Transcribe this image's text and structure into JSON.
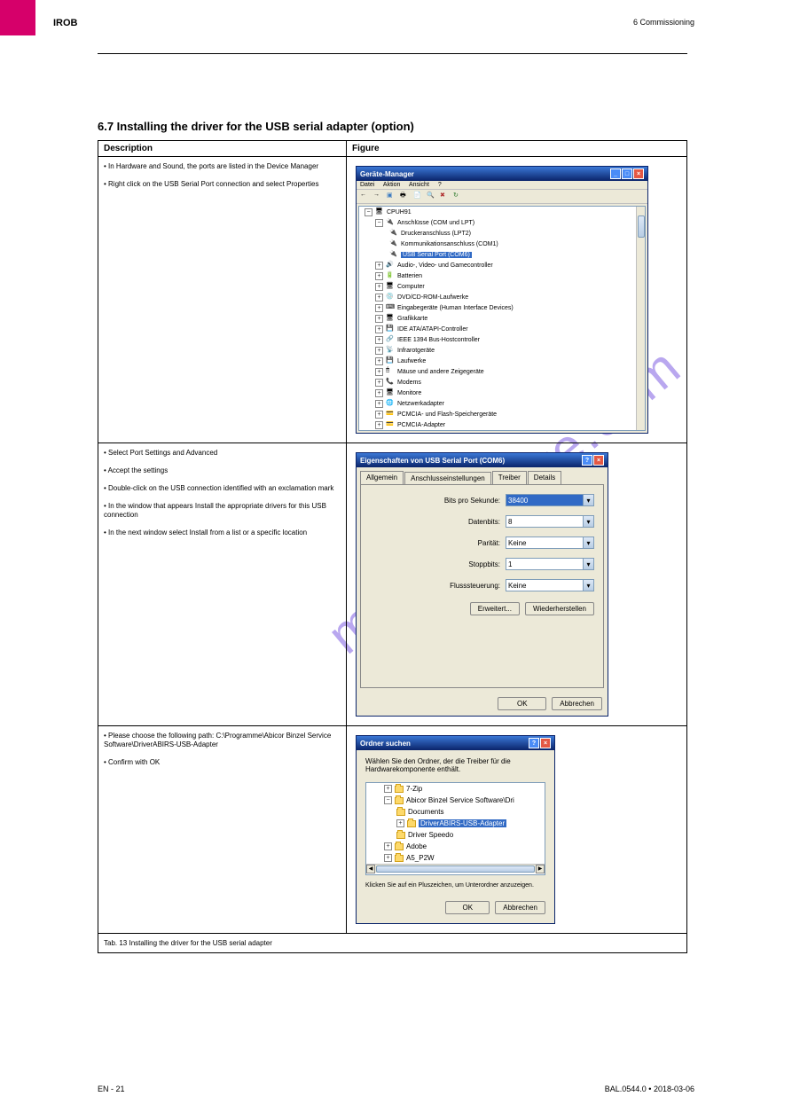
{
  "header": {
    "left": "IROB",
    "right": "6 Commissioning"
  },
  "section_title": "6.7 Installing the driver for the USB serial adapter (option)",
  "table": {
    "col1": "Description",
    "col2": "Figure",
    "row1": {
      "bullets": [
        "In Hardware and Sound, the ports are listed in the Device Manager",
        "Right click on the USB Serial Port connection and select Properties"
      ],
      "win_title": "Geräte-Manager",
      "menu": [
        "Datei",
        "Aktion",
        "Ansicht",
        "?"
      ],
      "tree": {
        "root": "CPUH91",
        "ports": "Anschlüsse (COM und LPT)",
        "port_items": [
          "Druckeranschluss (LPT2)",
          "Kommunikationsanschluss (COM1)",
          "USB Serial Port (COM6)"
        ],
        "others": [
          "Audio-, Video- und Gamecontroller",
          "Batterien",
          "Computer",
          "DVD/CD-ROM-Laufwerke",
          "Eingabegeräte (Human Interface Devices)",
          "Grafikkarte",
          "IDE ATA/ATAPI-Controller",
          "IEEE 1394 Bus-Hostcontroller",
          "Infrarotgeräte",
          "Laufwerke",
          "Mäuse und andere Zeigegeräte",
          "Modems",
          "Monitore",
          "Netzwerkadapter",
          "PCMCIA- und Flash-Speichergeräte",
          "PCMCIA-Adapter"
        ]
      }
    },
    "row2": {
      "bullets": [
        "Select Port Settings and Advanced",
        "Accept the settings",
        "Double-click on the USB connection identified with an exclamation mark",
        "In the window that appears Install the appropriate drivers for this USB connection",
        "In the next window select Install from a list or a specific location"
      ],
      "title": "Eigenschaften von USB Serial Port (COM6)",
      "tabs": [
        "Allgemein",
        "Anschlusseinstellungen",
        "Treiber",
        "Details"
      ],
      "fields": {
        "bps_label": "Bits pro Sekunde:",
        "bps_val": "38400",
        "data_label": "Datenbits:",
        "data_val": "8",
        "parity_label": "Parität:",
        "parity_val": "Keine",
        "stop_label": "Stoppbits:",
        "stop_val": "1",
        "flow_label": "Flusssteuerung:",
        "flow_val": "Keine"
      },
      "btn_adv": "Erweitert...",
      "btn_restore": "Wiederherstellen",
      "btn_ok": "OK",
      "btn_cancel": "Abbrechen"
    },
    "row3": {
      "bullets": [
        "Please choose the following path: C:\\Programme\\Abicor Binzel Service Software\\DriverABIRS-USB-Adapter",
        "Confirm with OK"
      ],
      "title": "Ordner suchen",
      "prompt": "Wählen Sie den Ordner, der die Treiber für die Hardwarekomponente enthält.",
      "tree": [
        "7-Zip",
        "Abicor Binzel Service Software\\Dri",
        "Documents",
        "DriverABIRS-USB-Adapter",
        "Driver Speedo",
        "Adobe",
        "A5_P2W"
      ],
      "hint": "Klicken Sie auf ein Pluszeichen, um Unterordner anzuzeigen.",
      "btn_ok": "OK",
      "btn_cancel": "Abbrechen"
    },
    "bottom": "Tab. 13 Installing the driver for the USB serial adapter"
  },
  "footer": {
    "left": "EN - 21",
    "right": "BAL.0544.0 • 2018-03-06"
  },
  "watermark": "manualshive.com"
}
